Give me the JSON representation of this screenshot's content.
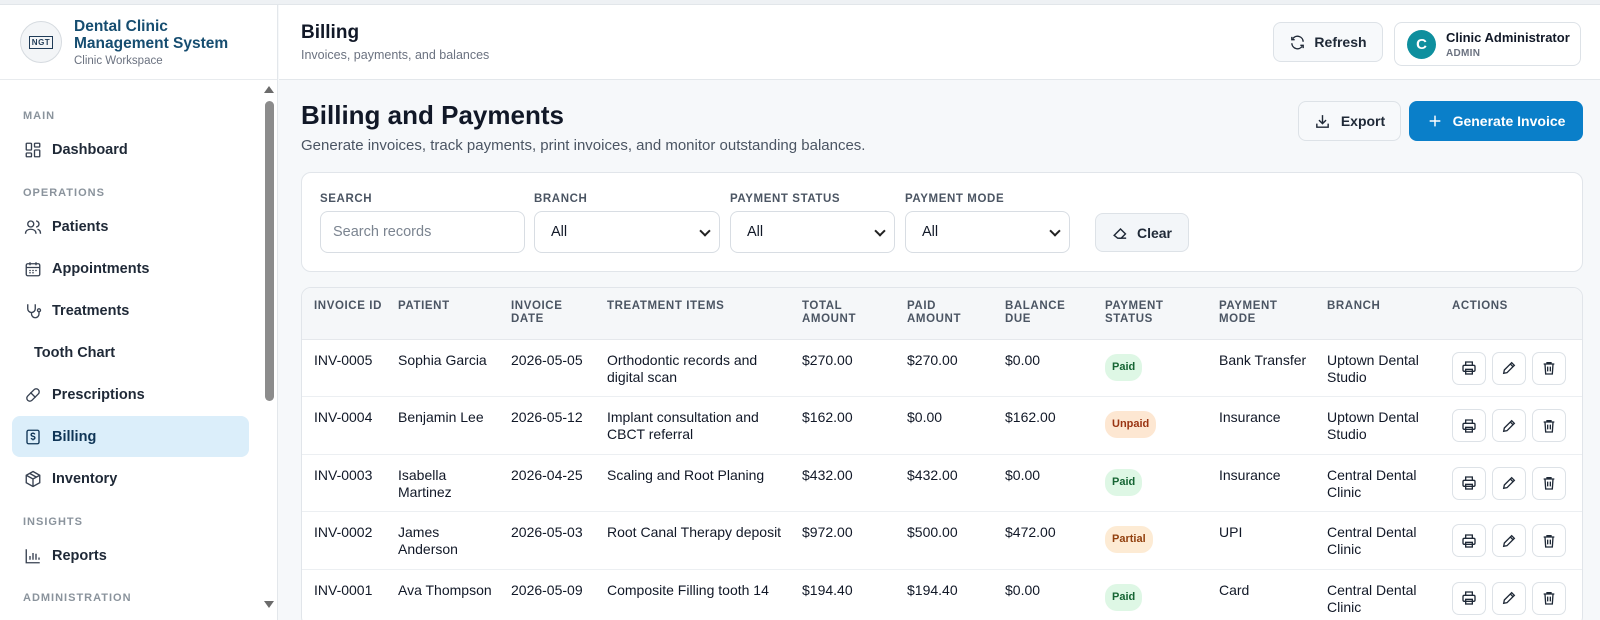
{
  "brand": {
    "title": "Dental Clinic Management System",
    "subtitle": "Clinic Workspace",
    "logo_text": "NGT"
  },
  "sidebar": {
    "sections": [
      {
        "label": "MAIN"
      },
      {
        "label": "OPERATIONS"
      },
      {
        "label": "INSIGHTS"
      },
      {
        "label": "ADMINISTRATION"
      }
    ],
    "items": [
      {
        "label": "Dashboard",
        "icon": "grid-icon"
      },
      {
        "label": "Patients",
        "icon": "users-icon"
      },
      {
        "label": "Appointments",
        "icon": "calendar-icon"
      },
      {
        "label": "Treatments",
        "icon": "stethoscope-icon"
      },
      {
        "label": "Tooth Chart",
        "icon": ""
      },
      {
        "label": "Prescriptions",
        "icon": "pill-icon"
      },
      {
        "label": "Billing",
        "icon": "receipt-icon",
        "active": true
      },
      {
        "label": "Inventory",
        "icon": "package-icon"
      },
      {
        "label": "Reports",
        "icon": "bar-chart-icon"
      }
    ]
  },
  "header": {
    "title": "Billing",
    "subtitle": "Invoices, payments, and balances",
    "refresh_label": "Refresh",
    "user": {
      "initial": "C",
      "name": "Clinic Administrator",
      "role": "ADMIN"
    }
  },
  "main": {
    "title": "Billing and Payments",
    "subtitle": "Generate invoices, track payments, print invoices, and monitor outstanding balances.",
    "export_label": "Export",
    "generate_label": "Generate Invoice"
  },
  "filters": {
    "search": {
      "label": "SEARCH",
      "placeholder": "Search records",
      "value": ""
    },
    "branch": {
      "label": "BRANCH",
      "value": "All"
    },
    "payment_status": {
      "label": "PAYMENT STATUS",
      "value": "All"
    },
    "payment_mode": {
      "label": "PAYMENT MODE",
      "value": "All"
    },
    "clear_label": "Clear"
  },
  "table": {
    "headers": [
      "INVOICE ID",
      "PATIENT",
      "INVOICE DATE",
      "TREATMENT ITEMS",
      "TOTAL AMOUNT",
      "PAID AMOUNT",
      "BALANCE DUE",
      "PAYMENT STATUS",
      "PAYMENT MODE",
      "BRANCH",
      "ACTIONS"
    ],
    "rows": [
      {
        "id": "INV-0005",
        "patient": "Sophia Garcia",
        "date": "2026-05-05",
        "items": "Orthodontic records and digital scan",
        "total": "$270.00",
        "paid": "$270.00",
        "balance": "$0.00",
        "status": "Paid",
        "status_kind": "paid",
        "mode": "Bank Transfer",
        "branch": "Uptown Dental Studio"
      },
      {
        "id": "INV-0004",
        "patient": "Benjamin Lee",
        "date": "2026-05-12",
        "items": "Implant consultation and CBCT referral",
        "total": "$162.00",
        "paid": "$0.00",
        "balance": "$162.00",
        "status": "Unpaid",
        "status_kind": "unpaid",
        "mode": "Insurance",
        "branch": "Uptown Dental Studio"
      },
      {
        "id": "INV-0003",
        "patient": "Isabella Martinez",
        "date": "2026-04-25",
        "items": "Scaling and Root Planing",
        "total": "$432.00",
        "paid": "$432.00",
        "balance": "$0.00",
        "status": "Paid",
        "status_kind": "paid",
        "mode": "Insurance",
        "branch": "Central Dental Clinic"
      },
      {
        "id": "INV-0002",
        "patient": "James Anderson",
        "date": "2026-05-03",
        "items": "Root Canal Therapy deposit",
        "total": "$972.00",
        "paid": "$500.00",
        "balance": "$472.00",
        "status": "Partial",
        "status_kind": "partial",
        "mode": "UPI",
        "branch": "Central Dental Clinic"
      },
      {
        "id": "INV-0001",
        "patient": "Ava Thompson",
        "date": "2026-05-09",
        "items": "Composite Filling tooth 14",
        "total": "$194.40",
        "paid": "$194.40",
        "balance": "$0.00",
        "status": "Paid",
        "status_kind": "paid",
        "mode": "Card",
        "branch": "Central Dental Clinic"
      }
    ]
  },
  "colors": {
    "primary": "#0a7fc9",
    "brand": "#164d70",
    "active_nav_bg": "#dbeefa",
    "avatar": "#0e8f9e"
  }
}
